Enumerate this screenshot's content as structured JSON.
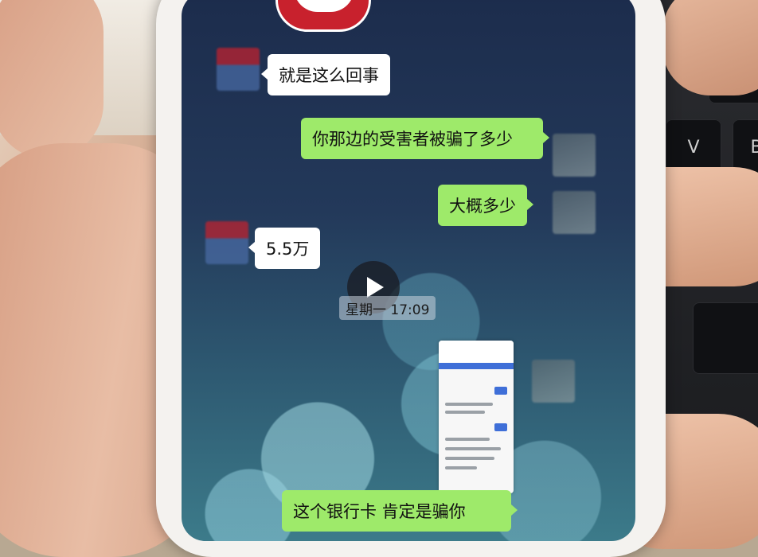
{
  "chat": {
    "messages": [
      {
        "side": "in",
        "text": "就是这么回事"
      },
      {
        "side": "out",
        "text": "你那边的受害者被骗了多少"
      },
      {
        "side": "out",
        "text": "大概多少"
      },
      {
        "side": "in",
        "text": "5.5万"
      },
      {
        "side": "out",
        "text": "这个银行卡 肯定是骗你"
      }
    ],
    "timestamp": "星期一 17:09"
  },
  "keyboard": {
    "v_key": "V",
    "b_key": "B"
  },
  "colors": {
    "outgoing_bubble": "#9eea6a",
    "incoming_bubble": "#ffffff",
    "play_overlay": "#19191e"
  },
  "icons": {
    "play": "play-icon"
  }
}
